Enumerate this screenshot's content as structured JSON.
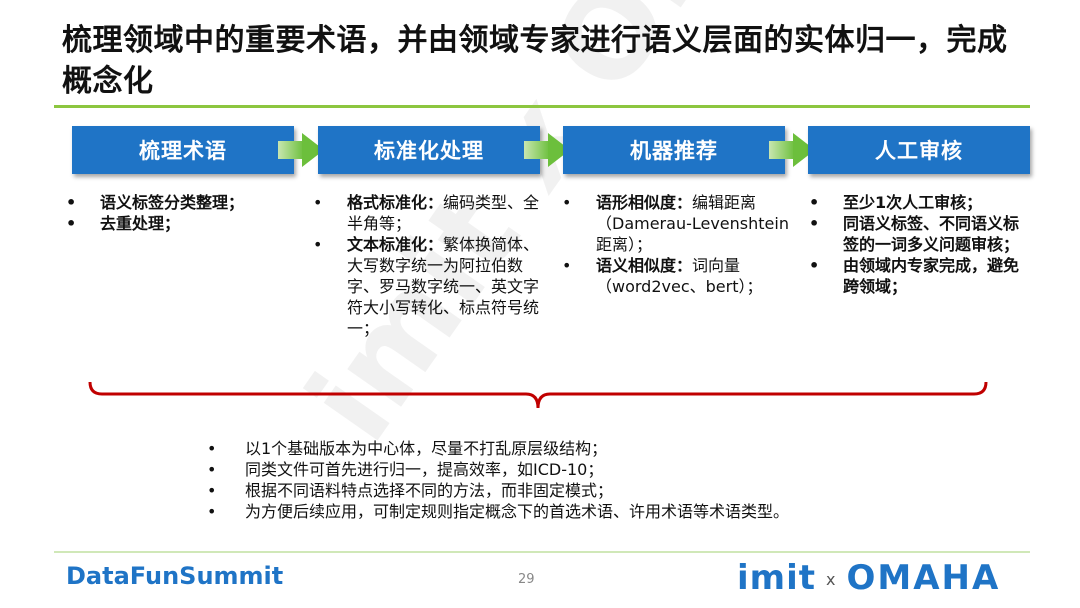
{
  "title": "梳理领域中的重要术语，并由领域专家进行语义层面的实体归一，完成概念化",
  "steps": [
    {
      "label": "梳理术语"
    },
    {
      "label": "标准化处理"
    },
    {
      "label": "机器推荐"
    },
    {
      "label": "人工审核"
    }
  ],
  "col1": {
    "items": [
      "语义标签分类整理；",
      "去重处理；"
    ]
  },
  "col2": {
    "item1_bold": "格式标准化：",
    "item1_text": "编码类型、全半角等；",
    "item2_bold": "文本标准化：",
    "item2_text": "繁体换简体、大写数字统一为阿拉伯数字、罗马数字统一、英文字符大小写转化、标点符号统一；"
  },
  "col3": {
    "item1_bold": "语形相似度：",
    "item1_text": "编辑距离（Damerau-Levenshtein距离）；",
    "item2_bold": "语义相似度：",
    "item2_text": "词向量（word2vec、bert）；"
  },
  "col4": {
    "items": [
      "至少1次人工审核；",
      "同语义标签、不同语义标签的一词多义问题审核；",
      "由领域内专家完成，避免跨领域；"
    ]
  },
  "bottom": {
    "items": [
      "以1个基础版本为中心体，尽量不打乱原层级结构；",
      "同类文件可首先进行归一，提高效率，如ICD-10；",
      "根据不同语料特点选择不同的方法，而非固定模式；",
      "为方便后续应用，可制定规则指定概念下的首选术语、许用术语等术语类型。"
    ]
  },
  "footer": {
    "brand": "DataFunSummit",
    "page": "29",
    "logo_imit": "imit",
    "logo_x": "x",
    "logo_omaha": "OMAHA"
  },
  "watermark": "imit x OMAHA",
  "colors": {
    "accent_blue": "#1f74c6",
    "accent_green": "#8cc63f",
    "brace_red": "#c00000"
  }
}
